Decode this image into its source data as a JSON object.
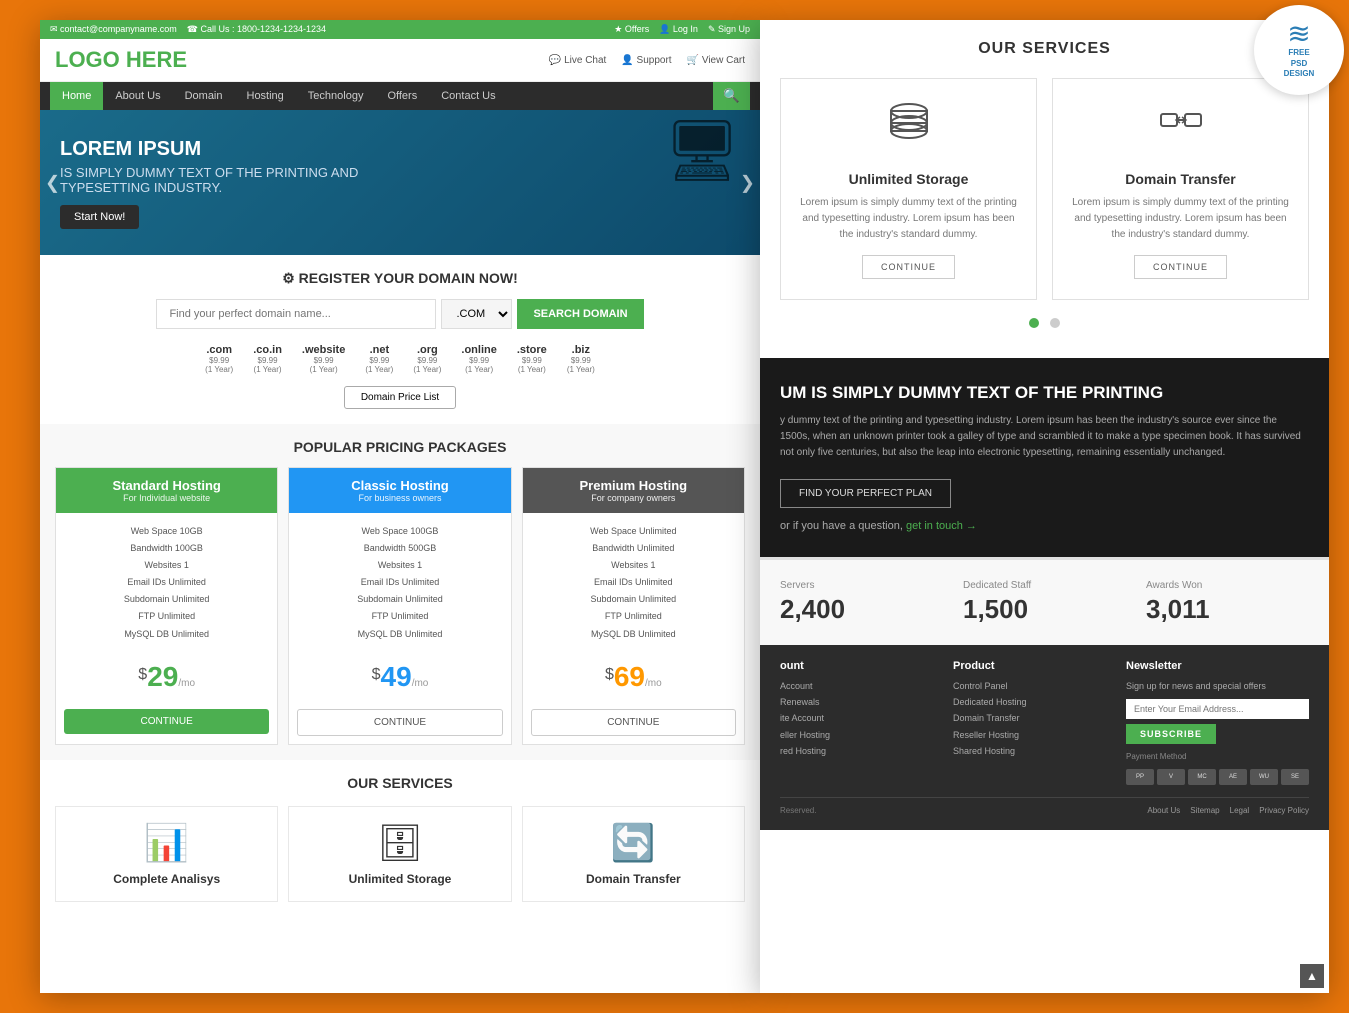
{
  "topbar": {
    "email": "✉ contact@companyname.com",
    "phone": "☎ Call Us : 1800-1234-1234-1234",
    "offers": "★ Offers",
    "login": "👤 Log In",
    "signup": "✎ Sign Up"
  },
  "header": {
    "logo_text": "LOGO",
    "logo_green": " HERE",
    "live_chat": "💬 Live Chat",
    "support": "👤 Support",
    "view_cart": "🛒 View Cart"
  },
  "nav": {
    "items": [
      {
        "label": "Home",
        "active": true
      },
      {
        "label": "About Us"
      },
      {
        "label": "Domain"
      },
      {
        "label": "Hosting"
      },
      {
        "label": "Technology"
      },
      {
        "label": "Offers"
      },
      {
        "label": "Contact Us"
      }
    ]
  },
  "hero": {
    "title": "LOREM IPSUM",
    "subtitle": "IS SIMPLY DUMMY TEXT OF THE PRINTING AND\nTYPESETTING INDUSTRY.",
    "btn_label": "Start Now!"
  },
  "domain": {
    "title": "⚙ REGISTER YOUR DOMAIN NOW!",
    "placeholder": "Find your perfect domain name...",
    "ext_default": ".COM ▾",
    "btn_label": "SEARCH DOMAIN",
    "extensions": [
      {
        "name": ".com",
        "price": "$9.99",
        "period": "(1 Year)"
      },
      {
        "name": ".co.in",
        "price": "$9.99",
        "period": "(1 Year)"
      },
      {
        "name": ".website",
        "price": "$9.99",
        "period": "(1 Year)"
      },
      {
        "name": ".net",
        "price": "$9.99",
        "period": "(1 Year)"
      },
      {
        "name": ".org",
        "price": "$9.99",
        "period": "(1 Year)"
      },
      {
        "name": ".online",
        "price": "$9.99",
        "period": "(1 Year)"
      },
      {
        "name": ".store",
        "price": "$9.99",
        "period": "(1 Year)"
      },
      {
        "name": ".biz",
        "price": "$9.99",
        "period": "(1 Year)"
      }
    ],
    "price_list_btn": "Domain Price List"
  },
  "pricing": {
    "title": "POPULAR PRICING PACKAGES",
    "plans": [
      {
        "name": "Standard Hosting",
        "sub": "For Individual website",
        "color": "green",
        "features": [
          "Web Space 10GB",
          "Bandwidth 100GB",
          "Websites 1",
          "Email IDs Unlimited",
          "Subdomain Unlimited",
          "FTP Unlimited",
          "MySQL DB Unlimited"
        ],
        "currency": "$",
        "price": "29",
        "per": "/mo",
        "btn_label": "CONTINUE",
        "btn_type": "green"
      },
      {
        "name": "Classic Hosting",
        "sub": "For business owners",
        "color": "blue",
        "features": [
          "Web Space 100GB",
          "Bandwidth 500GB",
          "Websites 1",
          "Email IDs Unlimited",
          "Subdomain Unlimited",
          "FTP Unlimited",
          "MySQL DB Unlimited"
        ],
        "currency": "$",
        "price": "49",
        "per": "/mo",
        "btn_label": "CONTINUE",
        "btn_type": "outline"
      },
      {
        "name": "Premium Hosting",
        "sub": "For company owners",
        "color": "dark",
        "features": [
          "Web Space Unlimited",
          "Bandwidth Unlimited",
          "Websites 1",
          "Email IDs Unlimited",
          "Subdomain Unlimited",
          "FTP Unlimited",
          "MySQL DB Unlimited"
        ],
        "currency": "$",
        "price": "69",
        "per": "/mo",
        "btn_label": "CONTINUE",
        "btn_type": "outline"
      }
    ]
  },
  "left_services": {
    "title": "OUR SERVICES",
    "items": [
      {
        "name": "Complete Analisys",
        "icon": "📊"
      },
      {
        "name": "Unlimited Storage",
        "icon": "🗄"
      },
      {
        "name": "Domain Transfer",
        "icon": "🔄"
      }
    ]
  },
  "right_services": {
    "title": "OUR SERVICES",
    "items": [
      {
        "name": "Unlimited Storage",
        "icon": "🗄",
        "desc": "Lorem ipsum is simply dummy text of the printing and typesetting industry. Lorem ipsum has been the industry's standard dummy.",
        "btn": "CONTINUE"
      },
      {
        "name": "Domain Transfer",
        "icon": "🔄",
        "desc": "Lorem ipsum is simply dummy text of the printing and typesetting industry. Lorem ipsum has been the industry's standard dummy.",
        "btn": "CONTINUE"
      }
    ],
    "dots": [
      true,
      false
    ]
  },
  "dark_section": {
    "title": "UM IS SIMPLY DUMMY TEXT OF THE PRINTING",
    "text": "y dummy text of the printing and typesetting industry. Lorem ipsum has been the industry's source ever since the 1500s, when an unknown printer took a galley of type and scrambled it to make a type specimen book. It has survived not only five centuries, but also the leap into electronic typesetting, remaining essentially unchanged.",
    "btn_label": "FIND YOUR PERFECT PLAN",
    "contact_text": "or if you have a question,",
    "contact_link": "get in touch →"
  },
  "stats": {
    "items": [
      {
        "label": "Servers",
        "value": "2,400"
      },
      {
        "label": "Dedicated Staff",
        "value": "1,500"
      },
      {
        "label": "Awards Won",
        "value": "3,011"
      }
    ]
  },
  "footer": {
    "cols": [
      {
        "title": "ount",
        "links": [
          "Account",
          "Renewals",
          "ite Account",
          "eller Hosting",
          "red Hosting"
        ]
      },
      {
        "title": "Product",
        "links": [
          "Control Panel",
          "Dedicated Hosting",
          "Domain Transfer",
          "Reseller Hosting",
          "Shared Hosting"
        ]
      }
    ],
    "newsletter": {
      "title": "Newsletter",
      "desc": "Sign up for news and special offers",
      "placeholder": "Enter Your Email Address...",
      "btn": "SUBSCRIBE"
    },
    "payment_label": "Payment Method",
    "payment_methods": [
      "PayPal",
      "VISA",
      "MC",
      "AE",
      "WU",
      "SEPA"
    ],
    "copyright": "Reserved.",
    "bottom_links": [
      "About Us",
      "Sitemap",
      "Legal",
      "Privacy Policy"
    ]
  },
  "badge": {
    "icon": "≋",
    "line1": "FREE",
    "line2": "PSD",
    "line3": "DESIGN"
  }
}
